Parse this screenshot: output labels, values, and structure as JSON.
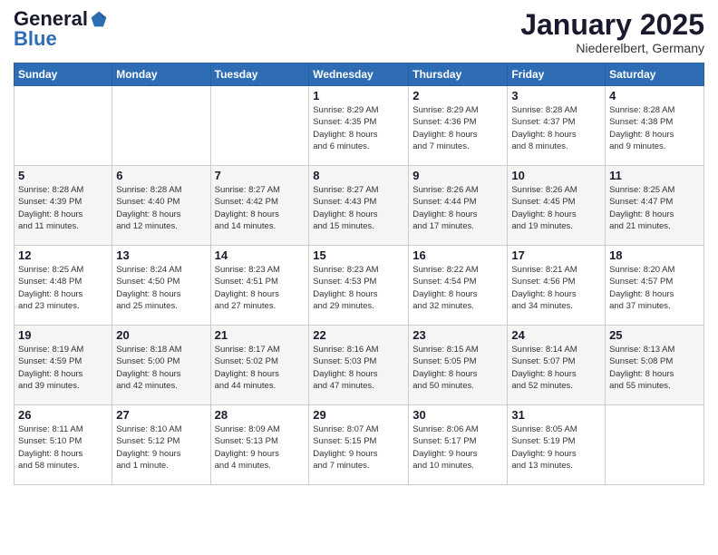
{
  "header": {
    "logo_general": "General",
    "logo_blue": "Blue",
    "month_title": "January 2025",
    "location": "Niederelbert, Germany"
  },
  "weekdays": [
    "Sunday",
    "Monday",
    "Tuesday",
    "Wednesday",
    "Thursday",
    "Friday",
    "Saturday"
  ],
  "weeks": [
    [
      {
        "day": "",
        "info": ""
      },
      {
        "day": "",
        "info": ""
      },
      {
        "day": "",
        "info": ""
      },
      {
        "day": "1",
        "info": "Sunrise: 8:29 AM\nSunset: 4:35 PM\nDaylight: 8 hours\nand 6 minutes."
      },
      {
        "day": "2",
        "info": "Sunrise: 8:29 AM\nSunset: 4:36 PM\nDaylight: 8 hours\nand 7 minutes."
      },
      {
        "day": "3",
        "info": "Sunrise: 8:28 AM\nSunset: 4:37 PM\nDaylight: 8 hours\nand 8 minutes."
      },
      {
        "day": "4",
        "info": "Sunrise: 8:28 AM\nSunset: 4:38 PM\nDaylight: 8 hours\nand 9 minutes."
      }
    ],
    [
      {
        "day": "5",
        "info": "Sunrise: 8:28 AM\nSunset: 4:39 PM\nDaylight: 8 hours\nand 11 minutes."
      },
      {
        "day": "6",
        "info": "Sunrise: 8:28 AM\nSunset: 4:40 PM\nDaylight: 8 hours\nand 12 minutes."
      },
      {
        "day": "7",
        "info": "Sunrise: 8:27 AM\nSunset: 4:42 PM\nDaylight: 8 hours\nand 14 minutes."
      },
      {
        "day": "8",
        "info": "Sunrise: 8:27 AM\nSunset: 4:43 PM\nDaylight: 8 hours\nand 15 minutes."
      },
      {
        "day": "9",
        "info": "Sunrise: 8:26 AM\nSunset: 4:44 PM\nDaylight: 8 hours\nand 17 minutes."
      },
      {
        "day": "10",
        "info": "Sunrise: 8:26 AM\nSunset: 4:45 PM\nDaylight: 8 hours\nand 19 minutes."
      },
      {
        "day": "11",
        "info": "Sunrise: 8:25 AM\nSunset: 4:47 PM\nDaylight: 8 hours\nand 21 minutes."
      }
    ],
    [
      {
        "day": "12",
        "info": "Sunrise: 8:25 AM\nSunset: 4:48 PM\nDaylight: 8 hours\nand 23 minutes."
      },
      {
        "day": "13",
        "info": "Sunrise: 8:24 AM\nSunset: 4:50 PM\nDaylight: 8 hours\nand 25 minutes."
      },
      {
        "day": "14",
        "info": "Sunrise: 8:23 AM\nSunset: 4:51 PM\nDaylight: 8 hours\nand 27 minutes."
      },
      {
        "day": "15",
        "info": "Sunrise: 8:23 AM\nSunset: 4:53 PM\nDaylight: 8 hours\nand 29 minutes."
      },
      {
        "day": "16",
        "info": "Sunrise: 8:22 AM\nSunset: 4:54 PM\nDaylight: 8 hours\nand 32 minutes."
      },
      {
        "day": "17",
        "info": "Sunrise: 8:21 AM\nSunset: 4:56 PM\nDaylight: 8 hours\nand 34 minutes."
      },
      {
        "day": "18",
        "info": "Sunrise: 8:20 AM\nSunset: 4:57 PM\nDaylight: 8 hours\nand 37 minutes."
      }
    ],
    [
      {
        "day": "19",
        "info": "Sunrise: 8:19 AM\nSunset: 4:59 PM\nDaylight: 8 hours\nand 39 minutes."
      },
      {
        "day": "20",
        "info": "Sunrise: 8:18 AM\nSunset: 5:00 PM\nDaylight: 8 hours\nand 42 minutes."
      },
      {
        "day": "21",
        "info": "Sunrise: 8:17 AM\nSunset: 5:02 PM\nDaylight: 8 hours\nand 44 minutes."
      },
      {
        "day": "22",
        "info": "Sunrise: 8:16 AM\nSunset: 5:03 PM\nDaylight: 8 hours\nand 47 minutes."
      },
      {
        "day": "23",
        "info": "Sunrise: 8:15 AM\nSunset: 5:05 PM\nDaylight: 8 hours\nand 50 minutes."
      },
      {
        "day": "24",
        "info": "Sunrise: 8:14 AM\nSunset: 5:07 PM\nDaylight: 8 hours\nand 52 minutes."
      },
      {
        "day": "25",
        "info": "Sunrise: 8:13 AM\nSunset: 5:08 PM\nDaylight: 8 hours\nand 55 minutes."
      }
    ],
    [
      {
        "day": "26",
        "info": "Sunrise: 8:11 AM\nSunset: 5:10 PM\nDaylight: 8 hours\nand 58 minutes."
      },
      {
        "day": "27",
        "info": "Sunrise: 8:10 AM\nSunset: 5:12 PM\nDaylight: 9 hours\nand 1 minute."
      },
      {
        "day": "28",
        "info": "Sunrise: 8:09 AM\nSunset: 5:13 PM\nDaylight: 9 hours\nand 4 minutes."
      },
      {
        "day": "29",
        "info": "Sunrise: 8:07 AM\nSunset: 5:15 PM\nDaylight: 9 hours\nand 7 minutes."
      },
      {
        "day": "30",
        "info": "Sunrise: 8:06 AM\nSunset: 5:17 PM\nDaylight: 9 hours\nand 10 minutes."
      },
      {
        "day": "31",
        "info": "Sunrise: 8:05 AM\nSunset: 5:19 PM\nDaylight: 9 hours\nand 13 minutes."
      },
      {
        "day": "",
        "info": ""
      }
    ]
  ]
}
